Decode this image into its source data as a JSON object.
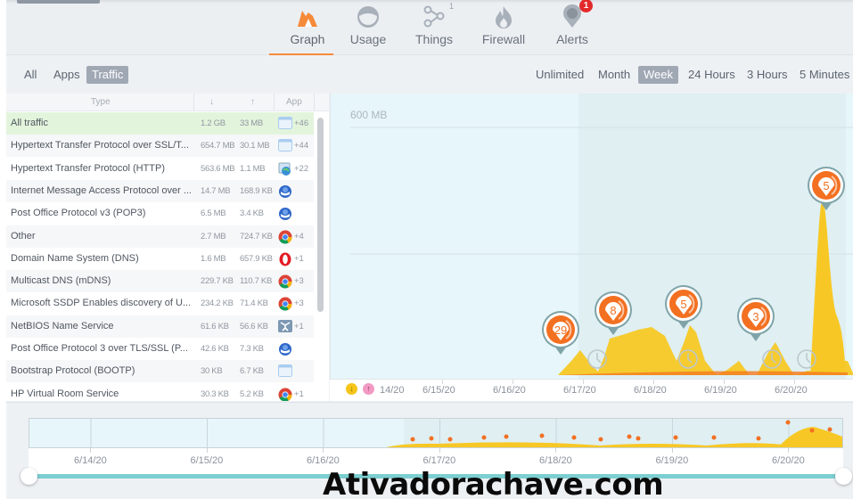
{
  "nav": {
    "tabs": [
      {
        "id": "graph",
        "label": "Graph",
        "icon": "graph-icon",
        "active": true
      },
      {
        "id": "usage",
        "label": "Usage",
        "icon": "usage-icon",
        "active": false
      },
      {
        "id": "things",
        "label": "Things",
        "icon": "things-icon",
        "active": false,
        "count": "1"
      },
      {
        "id": "firewall",
        "label": "Firewall",
        "icon": "firewall-icon",
        "active": false
      },
      {
        "id": "alerts",
        "label": "Alerts",
        "icon": "alerts-icon",
        "active": false,
        "badge": "1"
      }
    ],
    "accent_color": "#f58a3a"
  },
  "filters": {
    "view": [
      {
        "label": "All",
        "selected": false
      },
      {
        "label": "Apps",
        "selected": false
      },
      {
        "label": "Traffic",
        "selected": true
      }
    ],
    "range": [
      {
        "label": "Unlimited",
        "selected": false
      },
      {
        "label": "Month",
        "selected": false
      },
      {
        "label": "Week",
        "selected": true
      },
      {
        "label": "24 Hours",
        "selected": false
      },
      {
        "label": "3 Hours",
        "selected": false
      },
      {
        "label": "5 Minutes",
        "selected": false
      }
    ]
  },
  "table": {
    "headers": {
      "type": "Type",
      "down": "↓",
      "up": "↑",
      "app": "App"
    },
    "rows": [
      {
        "name": "All traffic",
        "down": "1.2 GB",
        "up": "33 MB",
        "app_icon": "window-icon",
        "more": "+46",
        "selected": true
      },
      {
        "name": "Hypertext Transfer Protocol over SSL/T...",
        "down": "654.7 MB",
        "up": "30.1 MB",
        "app_icon": "window-icon",
        "more": "+44"
      },
      {
        "name": "Hypertext Transfer Protocol (HTTP)",
        "down": "563.6 MB",
        "up": "1.1 MB",
        "app_icon": "globe-app-icon",
        "more": "+22"
      },
      {
        "name": "Internet Message Access Protocol over ...",
        "down": "14.7 MB",
        "up": "168.9 KB",
        "app_icon": "thunderbird-icon",
        "more": ""
      },
      {
        "name": "Post Office Protocol v3 (POP3)",
        "down": "6.5 MB",
        "up": "3.4 KB",
        "app_icon": "thunderbird-icon",
        "more": ""
      },
      {
        "name": "Other",
        "down": "2.7 MB",
        "up": "724.7 KB",
        "app_icon": "chrome-icon",
        "more": "+4"
      },
      {
        "name": "Domain Name System (DNS)",
        "down": "1.6 MB",
        "up": "657.9 KB",
        "app_icon": "opera-icon",
        "more": "+1"
      },
      {
        "name": "Multicast DNS (mDNS)",
        "down": "229.7 KB",
        "up": "110.7 KB",
        "app_icon": "chrome-icon",
        "more": "+3"
      },
      {
        "name": "Microsoft SSDP Enables discovery of U...",
        "down": "234.2 KB",
        "up": "71.4 KB",
        "app_icon": "chrome-icon",
        "more": "+3"
      },
      {
        "name": "NetBIOS Name Service",
        "down": "61.6 KB",
        "up": "56.6 KB",
        "app_icon": "network-icon",
        "more": "+1"
      },
      {
        "name": "Post Office Protocol 3 over TLS/SSL (P...",
        "down": "42.6 KB",
        "up": "7.3 KB",
        "app_icon": "thunderbird-icon",
        "more": ""
      },
      {
        "name": "Bootstrap Protocol (BOOTP)",
        "down": "30 KB",
        "up": "6.7 KB",
        "app_icon": "window-icon",
        "more": ""
      },
      {
        "name": "HP Virtual Room Service",
        "down": "30.3 KB",
        "up": "5.2 KB",
        "app_icon": "chrome-icon",
        "more": "+1"
      }
    ]
  },
  "graph": {
    "y_label": "600 MB",
    "x_labels": [
      "14/20",
      "6/15/20",
      "6/16/20",
      "6/17/20",
      "6/18/20",
      "6/19/20",
      "6/20/20"
    ],
    "legend": [
      {
        "name": "download",
        "color": "#f5c518"
      },
      {
        "name": "upload",
        "color": "#f29ac4"
      }
    ],
    "alert_markers": [
      {
        "count": "29",
        "day": 3.15
      },
      {
        "count": "8",
        "day": 3.4
      },
      {
        "count": "5",
        "day": 4.15
      },
      {
        "count": "3",
        "day": 5.15
      },
      {
        "count": "5",
        "day": 6.2
      }
    ],
    "clock_markers": [
      3.25,
      4.2,
      5.45,
      5.95
    ],
    "fill_color": "#f7c825",
    "upload_color": "#f47a20"
  },
  "overview": {
    "x_labels": [
      "6/14/20",
      "6/15/20",
      "6/16/20",
      "6/17/20",
      "6/18/20",
      "6/19/20",
      "6/20/20"
    ],
    "range_color": "#7ccfd1"
  },
  "watermark": "Ativadorachave.com"
}
